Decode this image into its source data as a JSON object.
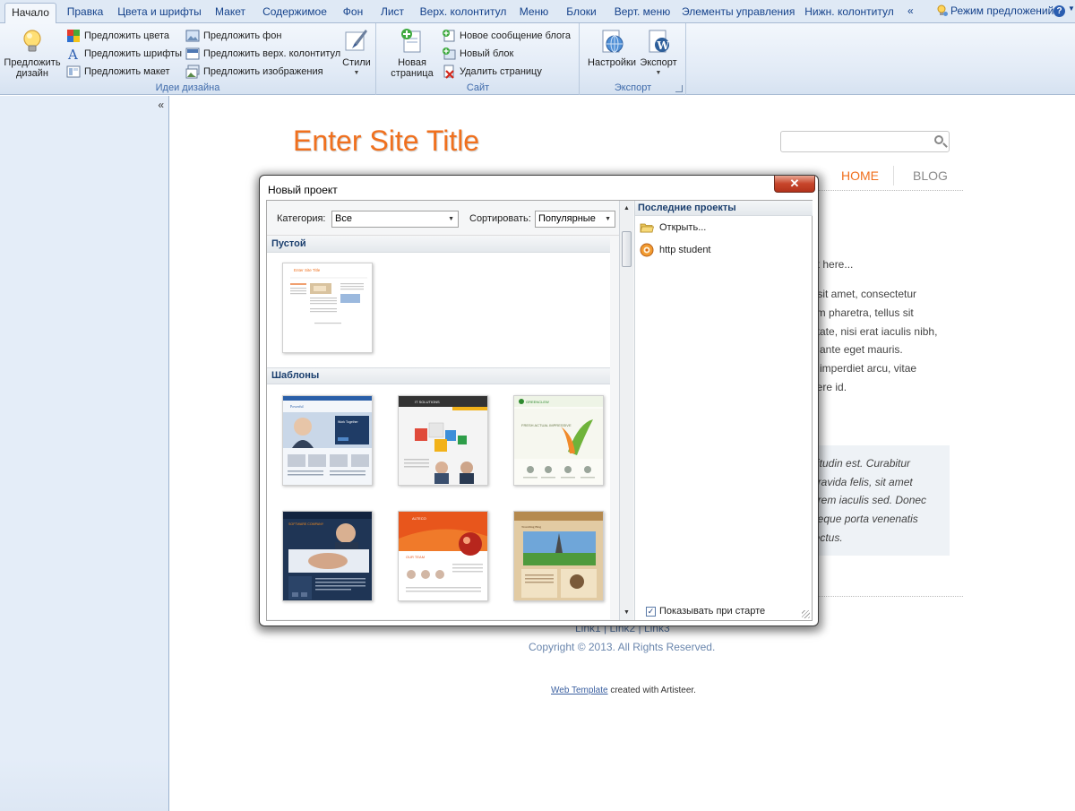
{
  "ribbon": {
    "tabs": [
      {
        "label": "Начало",
        "active": true
      },
      {
        "label": "Правка"
      },
      {
        "label": "Цвета и шрифты"
      },
      {
        "label": "Макет"
      },
      {
        "label": "Содержимое"
      },
      {
        "label": "Фон"
      },
      {
        "label": "Лист"
      },
      {
        "label": "Верх. колонтитул"
      },
      {
        "label": "Меню"
      },
      {
        "label": "Блоки"
      },
      {
        "label": "Верт. меню"
      },
      {
        "label": "Элементы управления"
      },
      {
        "label": "Нижн. колонтитул"
      }
    ],
    "more_tabs": "«",
    "suggest_mode": "Режим предложений",
    "help": "?",
    "groups": {
      "ideas": {
        "label": "Идеи дизайна",
        "suggest_design": "Предложить дизайн",
        "suggest_colors": "Предложить цвета",
        "suggest_fonts": "Предложить шрифты",
        "suggest_layout": "Предложить макет",
        "suggest_background": "Предложить фон",
        "suggest_header": "Предложить верх. колонтитул",
        "suggest_images": "Предложить изображения",
        "styles": "Стили"
      },
      "site": {
        "label": "Сайт",
        "new_page": "Новая страница",
        "new_blog_post": "Новое сообщение блога",
        "new_block": "Новый блок",
        "delete_page": "Удалить страницу"
      },
      "export": {
        "label": "Экспорт",
        "settings": "Настройки",
        "export": "Экспорт"
      }
    }
  },
  "left_panel": {
    "collapse": "«"
  },
  "preview": {
    "site_title": "Enter Site Title",
    "nav_home": "HOME",
    "nav_blog": "BLOG",
    "text_lines": [
      "nt here...",
      "r sit amet, consectetur",
      "am pharetra, tellus sit",
      "utate, nisi erat iaculis nibh,",
      "n ante eget mauris.",
      "n imperdiet arcu, vitae",
      "uere id."
    ],
    "quote_lines": [
      "situdin est. Curabitur",
      "gravida felis, sit amet",
      "orem iaculis sed. Donec",
      "neque porta venenatis",
      "lectus."
    ],
    "footer_links": "Link1 | Link2 | Link3",
    "copyright": "Copyright © 2013. All Rights Reserved.",
    "credit_link": "Web Template",
    "credit_rest": " created with Artisteer."
  },
  "dialog": {
    "title": "Новый проект",
    "close": "✕",
    "category_label": "Категория:",
    "category_value": "Все",
    "sort_label": "Сортировать:",
    "sort_value": "Популярные",
    "section_blank": "Пустой",
    "blank_thumb_title": "Enter Site Title",
    "section_templates": "Шаблоны",
    "templates": [
      {
        "name": "Powerful",
        "headline": "Work Together",
        "accent": "#2a5fa8"
      },
      {
        "name": "IT SOLUTIONS",
        "headline": "",
        "accent": "#f2b21a"
      },
      {
        "name": "GREENCLEW",
        "headline": "FRESH ACTUAL IMPRESSIVE",
        "accent": "#2e8a2e"
      },
      {
        "name": "SOFTWARE COMPANY",
        "headline": "",
        "accent": "#1f3555"
      },
      {
        "name": "ALTECO",
        "headline": "OUR TEAM",
        "accent": "#e8561c"
      },
      {
        "name": "Travelling Blog",
        "headline": "",
        "accent": "#b58a4f"
      }
    ],
    "recent_title": "Последние проекты",
    "recent_items": [
      "Открыть...",
      "http student"
    ],
    "show_on_start": "Показывать при старте",
    "show_on_start_checked": "✓"
  }
}
